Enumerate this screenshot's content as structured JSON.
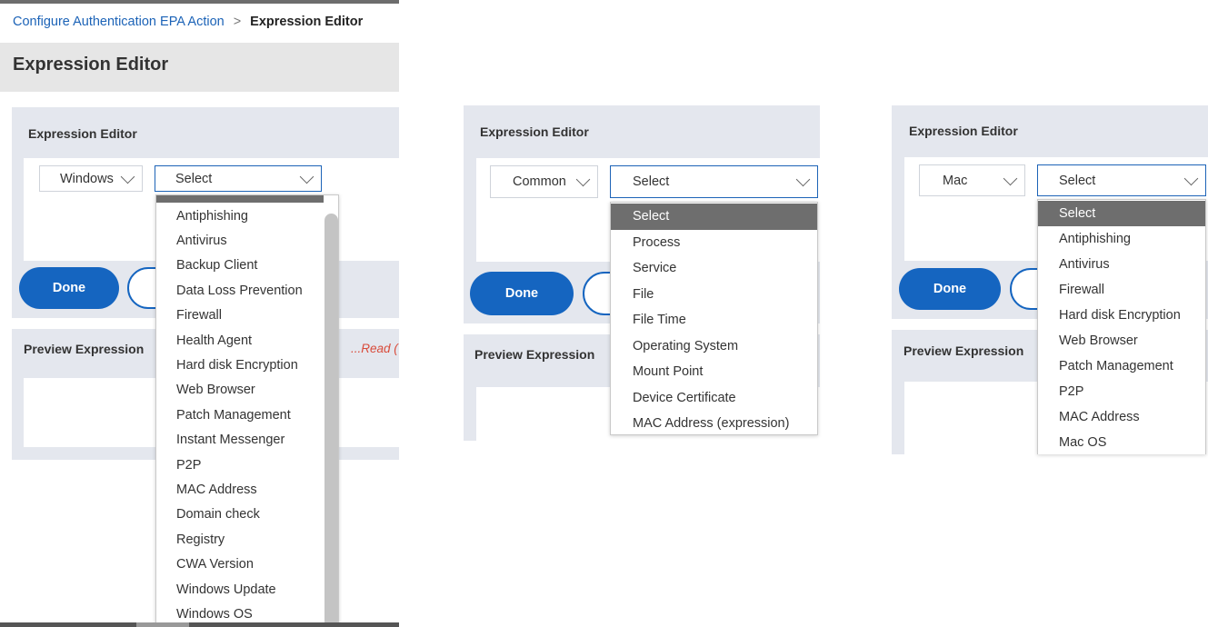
{
  "panel1": {
    "breadcrumb": {
      "parent": "Configure Authentication EPA Action",
      "separator": ">",
      "current": "Expression Editor"
    },
    "page_title": "Expression Editor",
    "card_title": "Expression Editor",
    "os_select": "Windows",
    "condition_select": "Select",
    "done_label": "Done",
    "preview_title": "Preview Expression",
    "read_hint": "...Read (",
    "options": [
      "Antiphishing",
      "Antivirus",
      "Backup Client",
      "Data Loss Prevention",
      "Firewall",
      "Health Agent",
      "Hard disk Encryption",
      "Web Browser",
      "Patch Management",
      "Instant Messenger",
      "P2P",
      "MAC Address",
      "Domain check",
      "Registry",
      "CWA Version",
      "Windows Update",
      "Windows OS"
    ]
  },
  "panel2": {
    "card_title": "Expression Editor",
    "os_select": "Common",
    "condition_select": "Select",
    "done_label": "Done",
    "preview_title": "Preview Expression",
    "options": [
      "Select",
      "Process",
      "Service",
      "File",
      "File Time",
      "Operating System",
      "Mount Point",
      "Device Certificate",
      "MAC Address (expression)"
    ],
    "selected_index": 0
  },
  "panel3": {
    "card_title": "Expression Editor",
    "os_select": "Mac",
    "condition_select": "Select",
    "done_label": "Done",
    "preview_title": "Preview Expression",
    "options": [
      "Select",
      "Antiphishing",
      "Antivirus",
      "Firewall",
      "Hard disk Encryption",
      "Web Browser",
      "Patch Management",
      "P2P",
      "MAC Address",
      "Mac OS"
    ],
    "selected_index": 0
  },
  "colors": {
    "accent": "#1565c0",
    "link": "#1c63b7",
    "card_bg": "#e4e7ee",
    "selected_option_bg": "#6e6e6e"
  },
  "icons": {
    "dropdown": "chevron-down-icon"
  }
}
